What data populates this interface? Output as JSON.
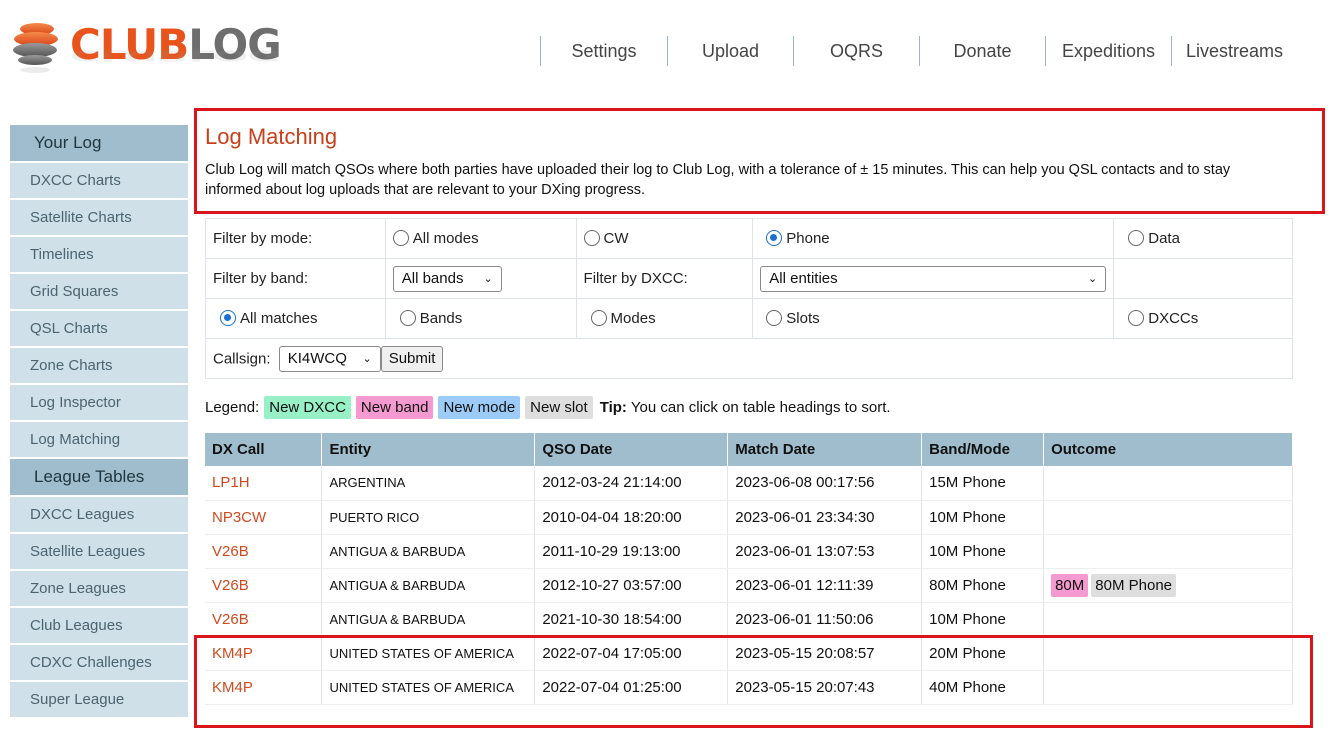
{
  "header": {
    "logo_club": "CLUB",
    "logo_log": "LOG",
    "nav": [
      "Settings",
      "Upload",
      "OQRS",
      "Donate",
      "Expeditions",
      "Livestreams"
    ]
  },
  "sidebar": {
    "section1": "Your Log",
    "items1": [
      "DXCC Charts",
      "Satellite Charts",
      "Timelines",
      "Grid Squares",
      "QSL Charts",
      "Zone Charts",
      "Log Inspector",
      "Log Matching"
    ],
    "section2": "League Tables",
    "items2": [
      "DXCC Leagues",
      "Satellite Leagues",
      "Zone Leagues",
      "Club Leagues",
      "CDXC Challenges",
      "Super League"
    ]
  },
  "main": {
    "title": "Log Matching",
    "intro": "Club Log will match QSOs where both parties have uploaded their log to Club Log, with a tolerance of ± 15 minutes. This can help you QSL contacts and to stay informed about log uploads that are relevant to your DXing progress."
  },
  "filters": {
    "mode_label": "Filter by mode:",
    "mode_options": [
      "All modes",
      "CW",
      "Phone",
      "Data"
    ],
    "mode_selected": "Phone",
    "band_label": "Filter by band:",
    "band_value": "All bands",
    "dxcc_label": "Filter by DXCC:",
    "dxcc_value": "All entities",
    "match_options": [
      "All matches",
      "Bands",
      "Modes",
      "Slots",
      "DXCCs"
    ],
    "match_selected": "All matches",
    "callsign_label": "Callsign:",
    "callsign_value": "KI4WCQ",
    "submit_label": "Submit"
  },
  "legend": {
    "label": "Legend:",
    "new_dxcc": "New DXCC",
    "new_band": "New band",
    "new_mode": "New mode",
    "new_slot": "New slot",
    "tip_bold": "Tip:",
    "tip_text": "You can click on table headings to sort."
  },
  "colors": {
    "new_dxcc": "#98f0c6",
    "new_band": "#f59ad0",
    "new_mode": "#9ccbf7",
    "new_slot": "#dedede",
    "accent": "#d04a1e",
    "highlight": "#d9141a"
  },
  "table": {
    "headers": [
      "DX Call",
      "Entity",
      "QSO Date",
      "Match Date",
      "Band/Mode",
      "Outcome"
    ],
    "rows": [
      {
        "call": "LP1H",
        "entity": "ARGENTINA",
        "qso": "2012-03-24 21:14:00",
        "match": "2023-06-08 00:17:56",
        "bandmode": "15M Phone",
        "outcome": []
      },
      {
        "call": "NP3CW",
        "entity": "PUERTO RICO",
        "qso": "2010-04-04 18:20:00",
        "match": "2023-06-01 23:34:30",
        "bandmode": "10M Phone",
        "outcome": []
      },
      {
        "call": "V26B",
        "entity": "ANTIGUA & BARBUDA",
        "qso": "2011-10-29 19:13:00",
        "match": "2023-06-01 13:07:53",
        "bandmode": "10M Phone",
        "outcome": []
      },
      {
        "call": "V26B",
        "entity": "ANTIGUA & BARBUDA",
        "qso": "2012-10-27 03:57:00",
        "match": "2023-06-01 12:11:39",
        "bandmode": "80M Phone",
        "outcome": [
          {
            "text": "80M",
            "kind": "new_band"
          },
          {
            "text": "80M Phone",
            "kind": "new_slot"
          }
        ]
      },
      {
        "call": "V26B",
        "entity": "ANTIGUA & BARBUDA",
        "qso": "2021-10-30 18:54:00",
        "match": "2023-06-01 11:50:06",
        "bandmode": "10M Phone",
        "outcome": []
      },
      {
        "call": "KM4P",
        "entity": "UNITED STATES OF AMERICA",
        "qso": "2022-07-04 17:05:00",
        "match": "2023-05-15 20:08:57",
        "bandmode": "20M Phone",
        "outcome": []
      },
      {
        "call": "KM4P",
        "entity": "UNITED STATES OF AMERICA",
        "qso": "2022-07-04 01:25:00",
        "match": "2023-05-15 20:07:43",
        "bandmode": "40M Phone",
        "outcome": []
      }
    ]
  }
}
